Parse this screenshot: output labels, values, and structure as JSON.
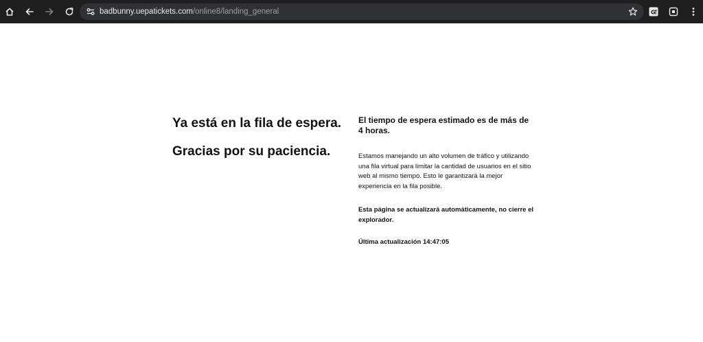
{
  "browser": {
    "url_host": "badbunny.uepatickets.com",
    "url_path": "/online8/landing_general",
    "icons": {
      "home": "home-icon",
      "back": "back-arrow-icon",
      "forward": "forward-arrow-icon",
      "reload": "reload-icon",
      "site_info": "tune-icon",
      "bookmark": "star-icon",
      "translate": "translate-icon",
      "extension": "extension-icon",
      "menu": "kebab-menu-icon"
    }
  },
  "queue": {
    "headline": "Ya está en la fila de espera.",
    "thanks": "Gracias por su paciencia.",
    "wait_title": "El tiempo de espera estimado es de más de 4 horas.",
    "description": "Estamos manejando un alto volumen de tráfico y utilizando una fila virtual para limitar la cantidad de usuarios en el sitio web al mismo tiempo. Esto le garantizará la mejor experiencia en la fila posible.",
    "auto_refresh_note": "Esta página se actualizará automáticamente, no cierre el explorador.",
    "last_update": "Última actualización 14:47:05"
  }
}
